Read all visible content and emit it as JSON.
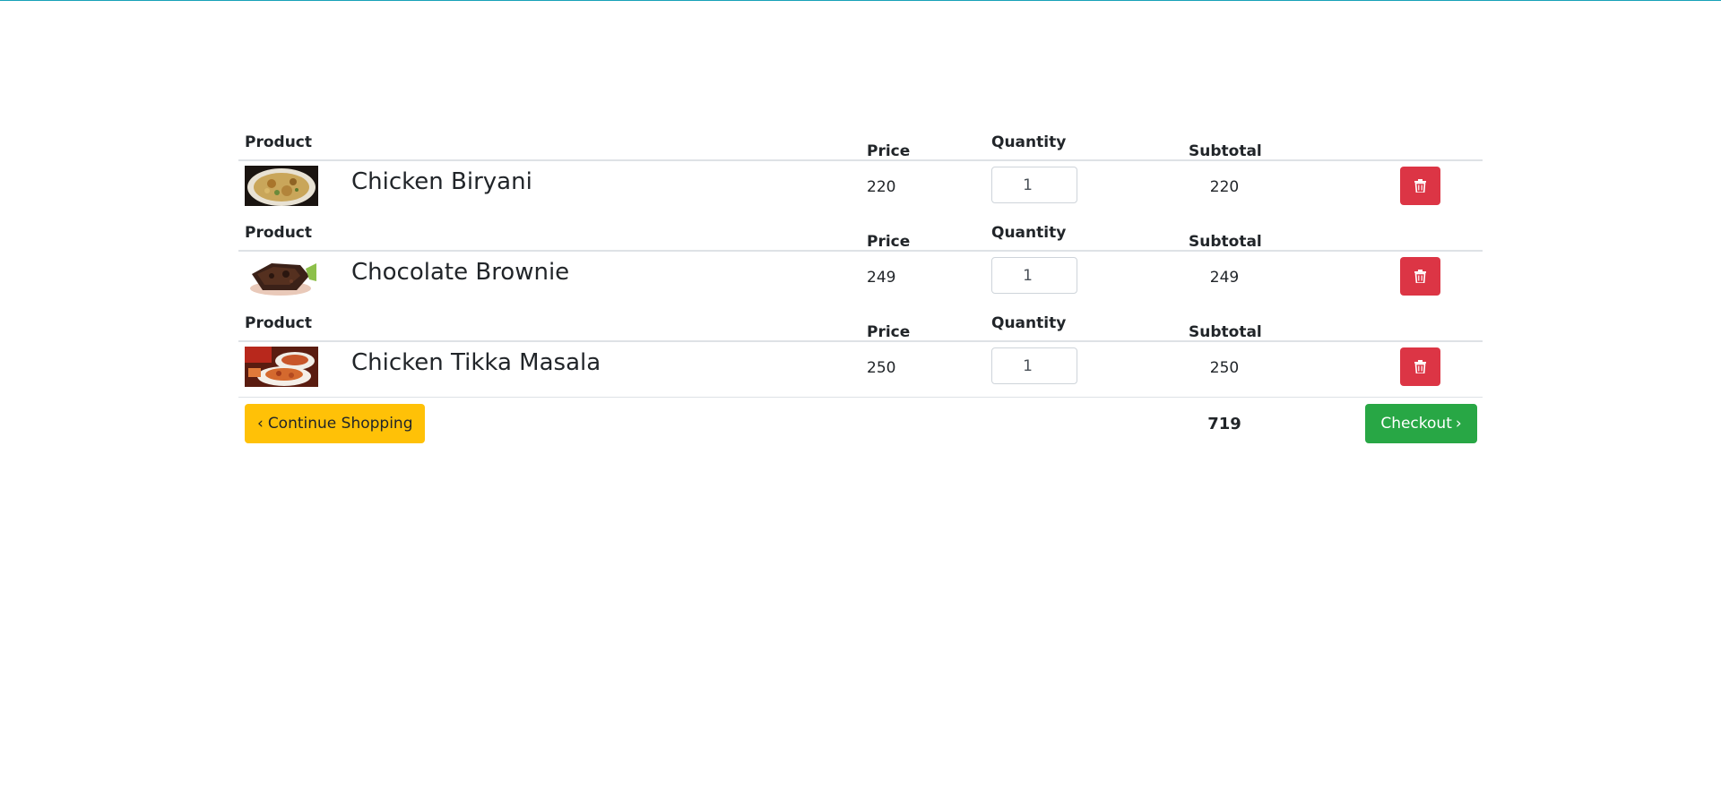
{
  "columns": {
    "product": "Product",
    "price": "Price",
    "quantity": "Quantity",
    "subtotal": "Subtotal"
  },
  "items": [
    {
      "name": "Chicken Biryani",
      "price": "220",
      "quantity": "1",
      "subtotal": "220",
      "image": "chicken-biryani-image"
    },
    {
      "name": "Chocolate Brownie",
      "price": "249",
      "quantity": "1",
      "subtotal": "249",
      "image": "chocolate-brownie-image"
    },
    {
      "name": "Chicken Tikka Masala",
      "price": "250",
      "quantity": "1",
      "subtotal": "250",
      "image": "chicken-tikka-masala-image"
    }
  ],
  "footer": {
    "continue_label": "Continue Shopping",
    "total": "719",
    "checkout_label": "Checkout"
  },
  "icons": {
    "delete": "trash-icon",
    "continue": "chevron-left-icon",
    "checkout": "chevron-right-icon"
  },
  "colors": {
    "delete": "#dc3545",
    "continue": "#ffc107",
    "checkout": "#28a745",
    "top_border": "#17a2b8"
  }
}
